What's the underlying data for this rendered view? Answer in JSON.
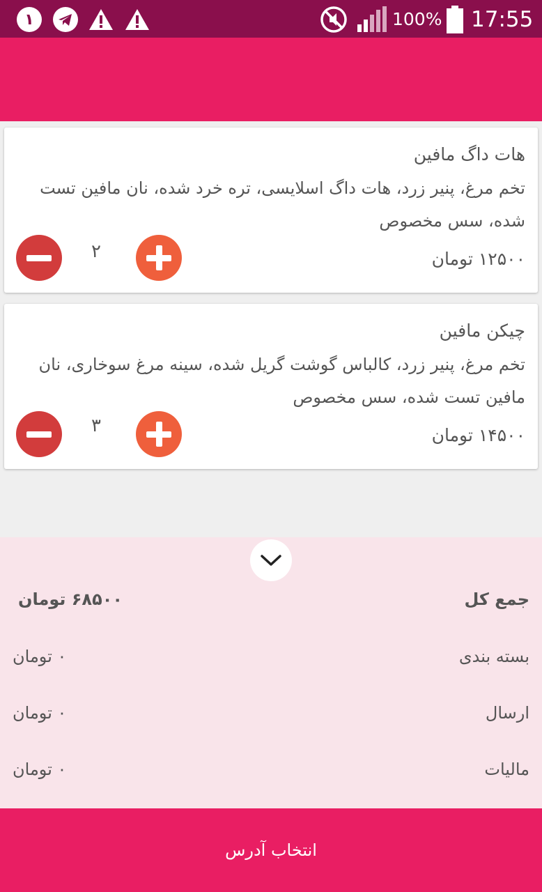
{
  "status_bar": {
    "notification_count": "۱",
    "battery_percent": "100%",
    "time": "17:55",
    "icons": [
      "notification-count-icon",
      "telegram-icon",
      "warning-icon",
      "warning-icon",
      "mute-icon",
      "signal-icon",
      "battery-icon"
    ]
  },
  "cart": {
    "items": [
      {
        "title": "هات داگ مافین",
        "description": "تخم مرغ، پنیر زرد، هات داگ اسلایسی، تره خرد شده، نان مافین تست شده، سس مخصوص",
        "price": "۱۲۵۰۰ تومان",
        "quantity": "۲"
      },
      {
        "title": "چیکن مافین",
        "description": "تخم مرغ، پنیر زرد، کالباس گوشت گریل شده، سینه مرغ سوخاری، نان مافین تست شده، سس مخصوص",
        "price": "۱۴۵۰۰ تومان",
        "quantity": "۳"
      }
    ]
  },
  "summary": {
    "total_label": "جمع کل",
    "total_value": "۶۸۵۰۰ تومان",
    "packaging_label": "بسته بندی",
    "packaging_value": "۰ تومان",
    "shipping_label": "ارسال",
    "shipping_value": "۰ تومان",
    "tax_label": "مالیات",
    "tax_value": "۰ تومان"
  },
  "footer": {
    "select_address_label": "انتخاب آدرس"
  },
  "colors": {
    "status_bar": "#8a0f4c",
    "primary": "#e91e63",
    "summary_bg": "#f9e4ea",
    "minus_button": "#d23c3c",
    "plus_button": "#ef5f3c"
  }
}
